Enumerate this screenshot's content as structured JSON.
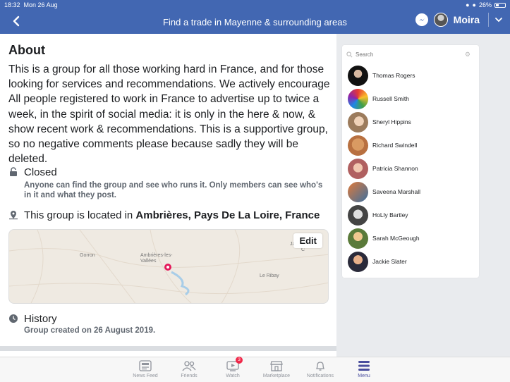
{
  "status_bar": {
    "time": "18:32",
    "date": "Mon 26 Aug",
    "battery": "26%"
  },
  "header": {
    "title": "Find a trade in Mayenne & surrounding areas",
    "user_name": "Moira"
  },
  "about": {
    "heading": "About",
    "description": "This is a group for all those working hard in France, and for those looking for services and recommendations. We actively encourage All people registered to work in France to advertise up to twice a week, in the spirit of social media: it is only in the here & now, & show recent work & recommendations. This is a supportive group, so no negative comments please because sadly they will be deleted.",
    "privacy_title": "Closed",
    "privacy_desc": "Anyone can find the group and see who runs it. Only members can see who's in it and what they post.",
    "location_prefix": "This group is located in",
    "location_place": "Ambrières, Pays De La Loire, France",
    "map": {
      "labels": [
        "Gorron",
        "Ambrières-les-Vallées",
        "Le Ribay",
        "Jav",
        "C"
      ],
      "edit_label": "Edit"
    },
    "history_title": "History",
    "history_desc": "Group created on 26 August 2019."
  },
  "members_panel": {
    "search_placeholder": "Search",
    "members": [
      {
        "name": "Thomas Rogers"
      },
      {
        "name": "Russell Smith"
      },
      {
        "name": "Sheryl Hippins"
      },
      {
        "name": "Richard Swindell"
      },
      {
        "name": "Patricia Shannon"
      },
      {
        "name": "Saveena Marshall"
      },
      {
        "name": "HoLly Bartley"
      },
      {
        "name": "Sarah McGeough"
      },
      {
        "name": "Jackie Slater"
      }
    ]
  },
  "tabbar": {
    "tabs": [
      {
        "label": "News Feed",
        "icon": "news-feed-icon"
      },
      {
        "label": "Friends",
        "icon": "friends-icon"
      },
      {
        "label": "Watch",
        "icon": "watch-icon",
        "badge": "3"
      },
      {
        "label": "Marketplace",
        "icon": "marketplace-icon"
      },
      {
        "label": "Notifications",
        "icon": "bell-icon"
      },
      {
        "label": "Menu",
        "icon": "menu-icon",
        "active": true
      }
    ]
  },
  "colors": {
    "brand": "#4267b2",
    "active_tab": "#4b4f9e",
    "badge": "#f02849",
    "map_pin": "#e4195a"
  }
}
